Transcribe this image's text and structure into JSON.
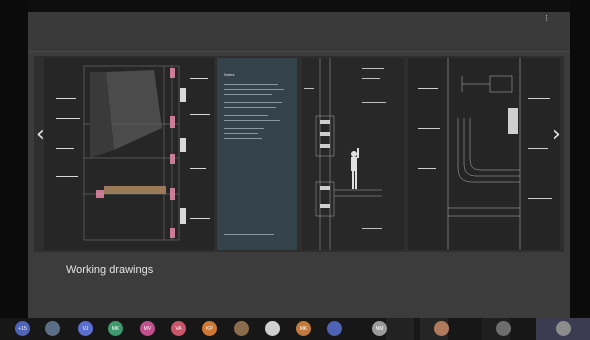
{
  "menu": {
    "icon": "more-vertical-icon",
    "glyph": "⁝"
  },
  "navigation": {
    "prev_icon": "chevron-left-icon",
    "prev_glyph": "‹",
    "next_icon": "chevron-right-icon",
    "next_glyph": "›"
  },
  "caption": "Working drawings",
  "panels": [
    {
      "id": "section-drawing",
      "kind": "architectural section"
    },
    {
      "id": "notes-panel",
      "kind": "text notes",
      "title": "Notes"
    },
    {
      "id": "detail-drawing-1",
      "kind": "construction detail"
    },
    {
      "id": "detail-drawing-2",
      "kind": "construction detail"
    }
  ],
  "participants": [
    {
      "initials": "+15",
      "color": "#4f64b8"
    },
    {
      "initials": "",
      "color": "#5a6f86",
      "photo": true
    },
    {
      "initials": "VJ",
      "color": "#5b6fd1"
    },
    {
      "initials": "MK",
      "color": "#3c9a6d"
    },
    {
      "initials": "MV",
      "color": "#c24f8c"
    },
    {
      "initials": "VA",
      "color": "#c9566a"
    },
    {
      "initials": "KP",
      "color": "#d2772f"
    },
    {
      "initials": "",
      "color": "#8a6c4d",
      "photo": true
    },
    {
      "initials": "",
      "color": "#cfcfcf",
      "photo": true
    },
    {
      "initials": "MK",
      "color": "#c47a3a"
    },
    {
      "initials": "",
      "color": "#4d63b3",
      "photo": true
    },
    {
      "initials": "NM",
      "color": "#9a9a9a"
    },
    {
      "initials": "",
      "color": "#b07a5c",
      "photo": true
    },
    {
      "initials": "",
      "color": "#6d6d6d",
      "photo": true
    },
    {
      "initials": "",
      "color": "#8c8c8c",
      "photo": true
    }
  ],
  "colors": {
    "viewer_bg": "#3c3c3c",
    "notes_panel": "#34434a",
    "highlight_pink": "#e58aa8",
    "timber": "#9a7a58",
    "taskbar": "#171717"
  }
}
